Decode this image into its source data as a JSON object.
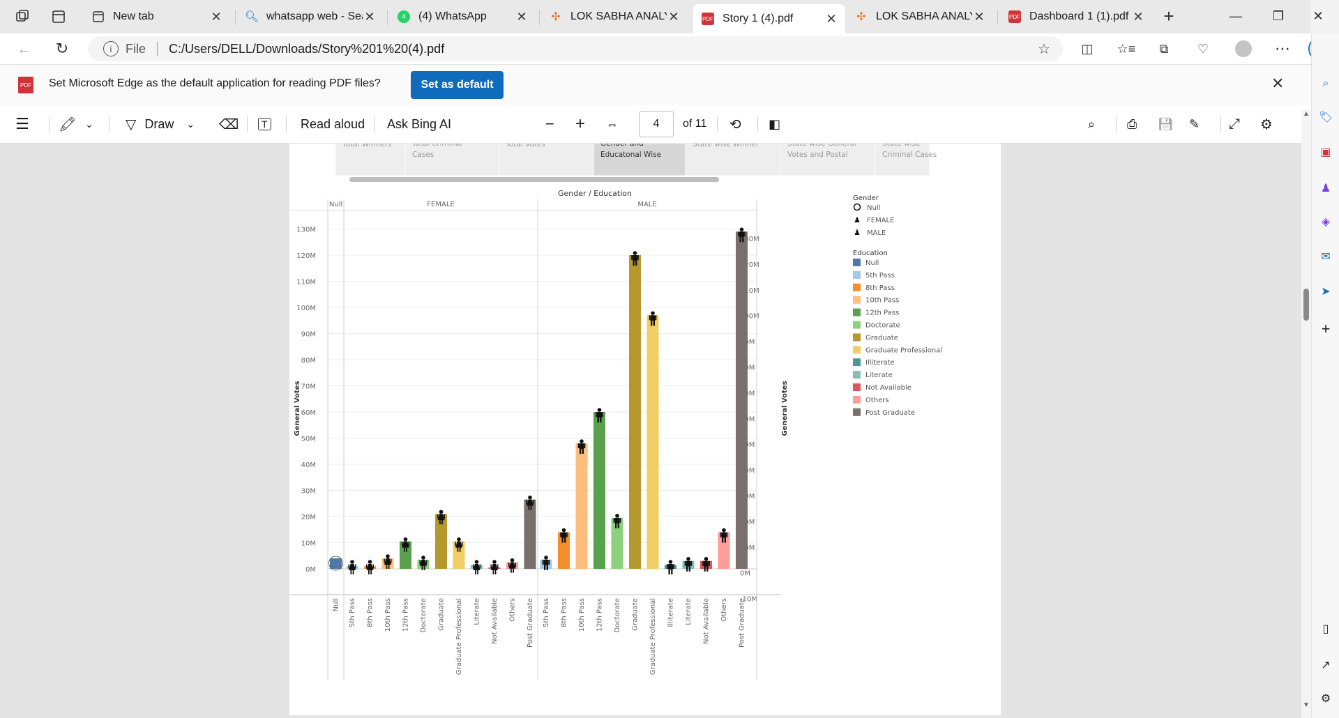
{
  "tabs": [
    {
      "label": "New tab",
      "icon": "new-tab-page-icon"
    },
    {
      "label": "whatsapp web - Sear",
      "icon": "bing-search-icon"
    },
    {
      "label": "(4) WhatsApp",
      "icon": "whatsapp-icon"
    },
    {
      "label": "LOK SABHA ANALYSI",
      "icon": "tableau-icon"
    },
    {
      "label": "Story 1 (4).pdf",
      "icon": "pdf-icon"
    },
    {
      "label": "LOK SABHA ANALYSI",
      "icon": "tableau-icon"
    },
    {
      "label": "Dashboard 1 (1).pdf",
      "icon": "pdf-icon"
    }
  ],
  "address": {
    "scheme": "File",
    "url": "C:/Users/DELL/Downloads/Story%201%20(4).pdf"
  },
  "infobar": {
    "message": "Set Microsoft Edge as the default application for reading PDF files?",
    "button": "Set as default"
  },
  "pdf_toolbar": {
    "draw": "Draw",
    "read_aloud": "Read aloud",
    "ask": "Ask Bing AI",
    "page": "4",
    "of_pages": "of 11"
  },
  "story_tabs": [
    "Total Winners",
    "Total Criminal Cases",
    "Total Votes",
    "Gender and Educatonal Wise Gen..",
    "State wise Winner",
    "State wise General Votes and Postal Votes",
    "State wise Criminal Cases"
  ],
  "colors": {
    "accent": "#0f6cbd",
    "Null": "#4e79a7",
    "5th Pass": "#a0cbe8",
    "8th Pass": "#f28e2b",
    "10th Pass": "#ffbe7d",
    "12th Pass": "#59a14f",
    "Doctorate": "#8cd17d",
    "Graduate": "#b6992d",
    "Graduate Professional": "#f1ce63",
    "Illiterate": "#499894",
    "Literate": "#86bcb6",
    "Not Available": "#e15759",
    "Others": "#ff9d9a",
    "Post Graduate": "#79706e"
  },
  "chart_data": {
    "type": "bar",
    "title": "Gender / Education",
    "ylabel": "General Votes",
    "ylim": [
      -10,
      130
    ],
    "yticks_left": [
      "130M",
      "120M",
      "110M",
      "100M",
      "90M",
      "80M",
      "70M",
      "60M",
      "50M",
      "40M",
      "30M",
      "20M",
      "10M",
      "0M"
    ],
    "yticks_right": [
      "130M",
      "120M",
      "110M",
      "100M",
      "90M",
      "80M",
      "70M",
      "60M",
      "50M",
      "40M",
      "30M",
      "20M",
      "10M",
      "0M",
      "-10M"
    ],
    "panels": [
      {
        "name": "Null",
        "categories": [
          "Null"
        ],
        "values": [
          4
        ]
      },
      {
        "name": "FEMALE",
        "categories": [
          "5th Pass",
          "8th Pass",
          "10th Pass",
          "12th Pass",
          "Doctorate",
          "Graduate",
          "Graduate Professional",
          "Literate",
          "Not Available",
          "Others",
          "Post Graduate"
        ],
        "values": [
          1,
          1,
          4,
          10.5,
          3.5,
          21,
          10.5,
          1.5,
          0.5,
          2.5,
          26.5
        ]
      },
      {
        "name": "MALE",
        "categories": [
          "5th Pass",
          "8th Pass",
          "10th Pass",
          "12th Pass",
          "Doctorate",
          "Graduate",
          "Graduate Professional",
          "Illiterate",
          "Literate",
          "Not Available",
          "Others",
          "Post Graduate"
        ],
        "values": [
          3.5,
          14,
          48,
          60,
          19.5,
          120,
          97,
          1.5,
          3,
          3,
          14,
          129
        ]
      }
    ],
    "legend": {
      "gender_title": "Gender",
      "gender": [
        "Null",
        "FEMALE",
        "MALE"
      ],
      "education_title": "Education",
      "education": [
        "Null",
        "5th Pass",
        "8th Pass",
        "10th Pass",
        "12th Pass",
        "Doctorate",
        "Graduate",
        "Graduate Professional",
        "Illiterate",
        "Literate",
        "Not Available",
        "Others",
        "Post Graduate"
      ]
    },
    "legend_position": "right",
    "grid": true
  }
}
